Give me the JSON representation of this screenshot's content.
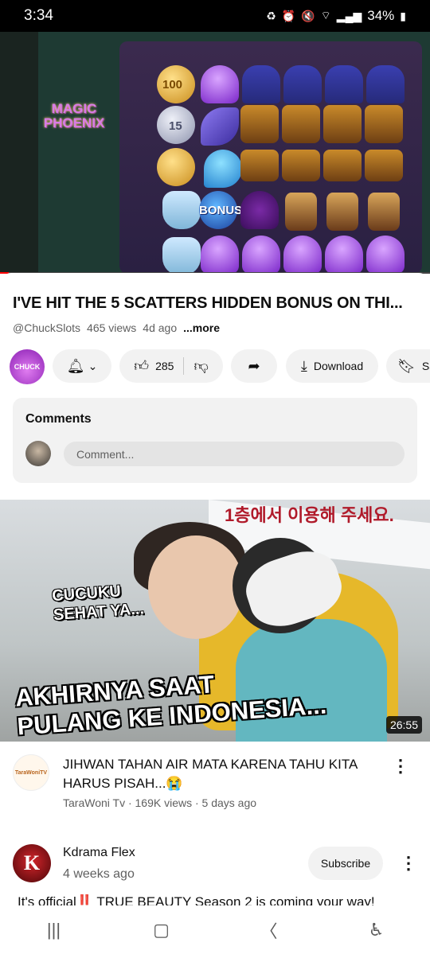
{
  "status_bar": {
    "time": "3:34",
    "battery": "34%",
    "icons": [
      "sync-icon",
      "alarm-icon",
      "mute-icon",
      "wifi-icon",
      "signal-icon",
      "battery-icon"
    ]
  },
  "player": {
    "game_logo": "MAGIC PHOENIX",
    "symbols": [
      "100",
      "15",
      "BONUS"
    ],
    "progress_fraction": 0.02,
    "accent": "#ff0000"
  },
  "video": {
    "title": "I'VE HIT THE 5 SCATTERS HIDDEN BONUS ON THI...",
    "channel_handle": "@ChuckSlots",
    "views": "465 views",
    "age": "4d ago",
    "more_label": "...more",
    "channel_avatar_text": "CHUCK"
  },
  "actions": {
    "like_count": "285",
    "download_label": "Download",
    "save_label": "Sa"
  },
  "comments": {
    "title": "Comments",
    "placeholder": "Comment..."
  },
  "next_video": {
    "thumbnail_banner": "1층에서 이용해 주세요.",
    "overlay_small": "CUCUKU SEHAT YA...",
    "overlay_main_line1": "AKHIRNYA SAAT",
    "overlay_main_line2": "PULANG KE INDONESIA...",
    "duration": "26:55",
    "title": "JIHWAN TAHAN AIR MATA KARENA TAHU KITA HARUS PISAH...😭",
    "meta": "TaraWoni Tv · 169K views · 5 days ago",
    "channel_avatar_text": "TaraWoniTV"
  },
  "post": {
    "channel": "Kdrama Flex",
    "time": "4 weeks ago",
    "avatar_letter": "K",
    "subscribe_label": "Subscribe",
    "text": "It's official‼️ TRUE BEAUTY Season 2 is coming your way!"
  }
}
